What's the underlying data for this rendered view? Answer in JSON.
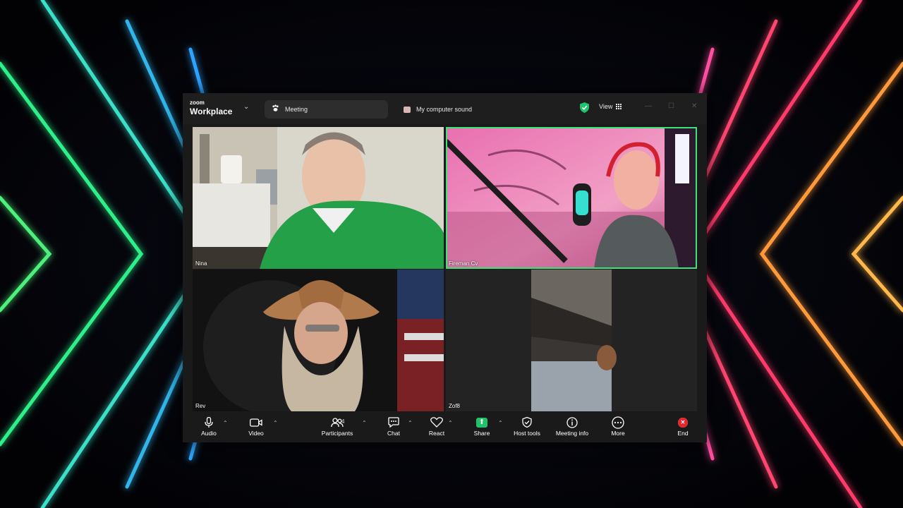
{
  "app": {
    "brand_small": "zoom",
    "brand_name": "Workplace",
    "tabs": [
      {
        "label": "Meeting",
        "icon": "paw-icon"
      },
      {
        "label": "My computer sound",
        "icon": "screen-share-icon"
      }
    ],
    "view_label": "View",
    "accent": "#3ce37b"
  },
  "participants": [
    {
      "name": "Nina",
      "active_speaker": false
    },
    {
      "name": "Fireman Cv",
      "active_speaker": true
    },
    {
      "name": "Rev",
      "active_speaker": false
    },
    {
      "name": "Zof8",
      "active_speaker": false
    }
  ],
  "toolbar": {
    "audio": "Audio",
    "video": "Video",
    "participants": "Participants",
    "participants_count": "4",
    "chat": "Chat",
    "react": "React",
    "share": "Share",
    "host_tools": "Host tools",
    "meeting_info": "Meeting info",
    "more": "More",
    "end": "End",
    "share_color": "#1ec46a",
    "end_color": "#e5252b"
  }
}
